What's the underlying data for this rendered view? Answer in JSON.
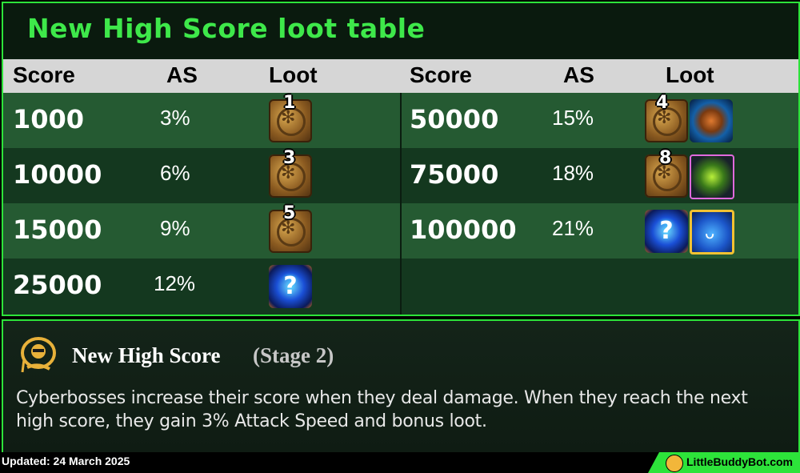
{
  "title": "New High Score loot table",
  "headers": {
    "left": [
      "Score",
      "AS",
      "Loot"
    ],
    "right": [
      "Score",
      "AS",
      "Loot"
    ]
  },
  "left_rows": [
    {
      "score": "1000",
      "as": "3%",
      "loot_badge": "1",
      "loot_icon": "coin-stack-icon"
    },
    {
      "score": "10000",
      "as": "6%",
      "loot_badge": "3",
      "loot_icon": "coin-stack-icon"
    },
    {
      "score": "15000",
      "as": "9%",
      "loot_badge": "5",
      "loot_icon": "coin-stack-icon"
    },
    {
      "score": "25000",
      "as": "12%",
      "loot_badge": "",
      "loot_icon": "mystery-orb-icon"
    }
  ],
  "right_rows": [
    {
      "score": "50000",
      "as": "15%",
      "loot_badge": "4",
      "loot_icons": [
        "coin-stack-icon",
        "champion-ball-icon"
      ]
    },
    {
      "score": "75000",
      "as": "18%",
      "loot_badge": "8",
      "loot_icons": [
        "coin-stack-icon",
        "green-component-icon"
      ]
    },
    {
      "score": "100000",
      "as": "21%",
      "loot_badge": "",
      "loot_icons": [
        "mystery-orb-icon",
        "monster-egg-icon"
      ]
    }
  ],
  "mystery_glyph": "?",
  "augment": {
    "name": "New High Score",
    "stage": "(Stage 2)",
    "description": "Cyberbosses increase their score when they deal damage. When they reach the next high score, they gain 3% Attack Speed and bonus loot.",
    "icon": "augment-icon"
  },
  "footer": {
    "updated": "Updated: 24 March 2025",
    "brand": "LittleBuddyBot.com"
  },
  "colors": {
    "accent": "#2de33a",
    "row_dark": "#14381f",
    "row_light": "#255a32",
    "header_bg": "#d6d6d6"
  }
}
